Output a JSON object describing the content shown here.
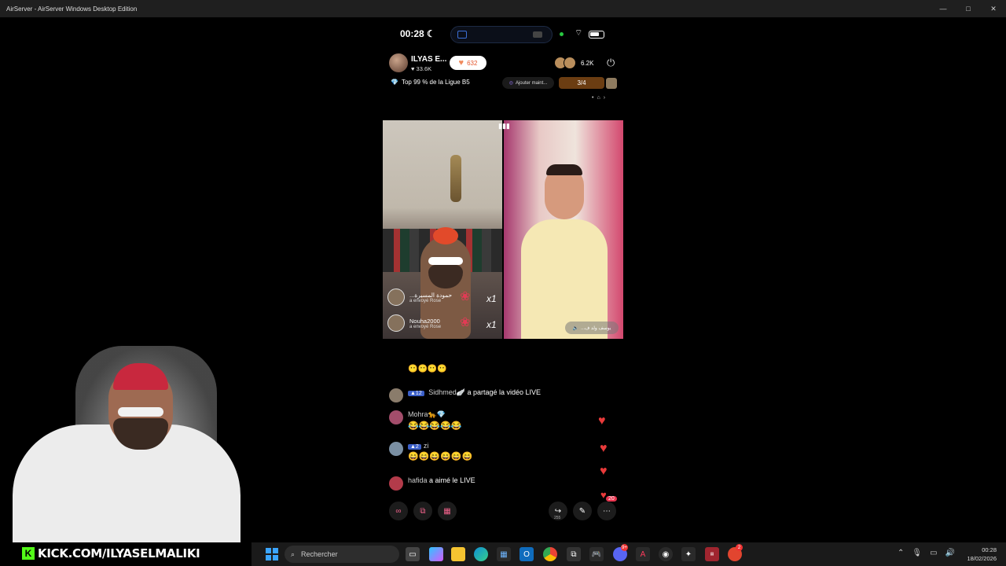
{
  "window": {
    "title": "AirServer - AirServer Windows Desktop Edition",
    "controls": {
      "minimize": "—",
      "maximize": "□",
      "close": "✕"
    }
  },
  "phone": {
    "status": {
      "time": "00:28",
      "moon": "☾",
      "wifi": "📶"
    },
    "host": {
      "name": "ILYAS E...",
      "likes": "33.6K",
      "follow_count": "632"
    },
    "viewers": {
      "count": "6.2K"
    },
    "league": {
      "text": "Top 99 % de la Ligue B5"
    },
    "add_now": {
      "label": "Ajouter maint..."
    },
    "match": {
      "count": "3/4"
    },
    "gifts": [
      {
        "name": "...حمودة المسيرة",
        "sub": "a envoyé Rose",
        "multiplier": "x1"
      },
      {
        "name": "Nouha2000",
        "sub": "a envoyé Rose",
        "multiplier": "x1"
      }
    ],
    "speaker_tag": {
      "text": "...يوسف ولد ف"
    },
    "chat": {
      "top_emojis": "😶😶😶😶",
      "messages": [
        {
          "badge": "12",
          "user": "Sidhmed🪽",
          "text": "a partagé la vidéo LIVE"
        },
        {
          "badge": "",
          "user": "Mohra🐆💎",
          "text": "😂😂😂😂😂"
        },
        {
          "badge": "2",
          "user": "zi",
          "text": "😄😄😄😄😄😄"
        },
        {
          "badge": "",
          "user": "hafida",
          "text": "a aimé le LIVE"
        }
      ]
    },
    "bottombar": {
      "share_count": "255",
      "notif_count": "20"
    }
  },
  "overlay": {
    "kick_url": "KICK.COM/ILYASELMALIKI"
  },
  "taskbar": {
    "search_placeholder": "Rechercher",
    "clock_time": "00:28",
    "clock_date": "18/02/2026",
    "badges": {
      "discord": "9+",
      "game": "2"
    }
  },
  "colors": {
    "accent": "#e83a3a",
    "kick_green": "#53fc18",
    "badge_blue": "#3b5fc8"
  }
}
